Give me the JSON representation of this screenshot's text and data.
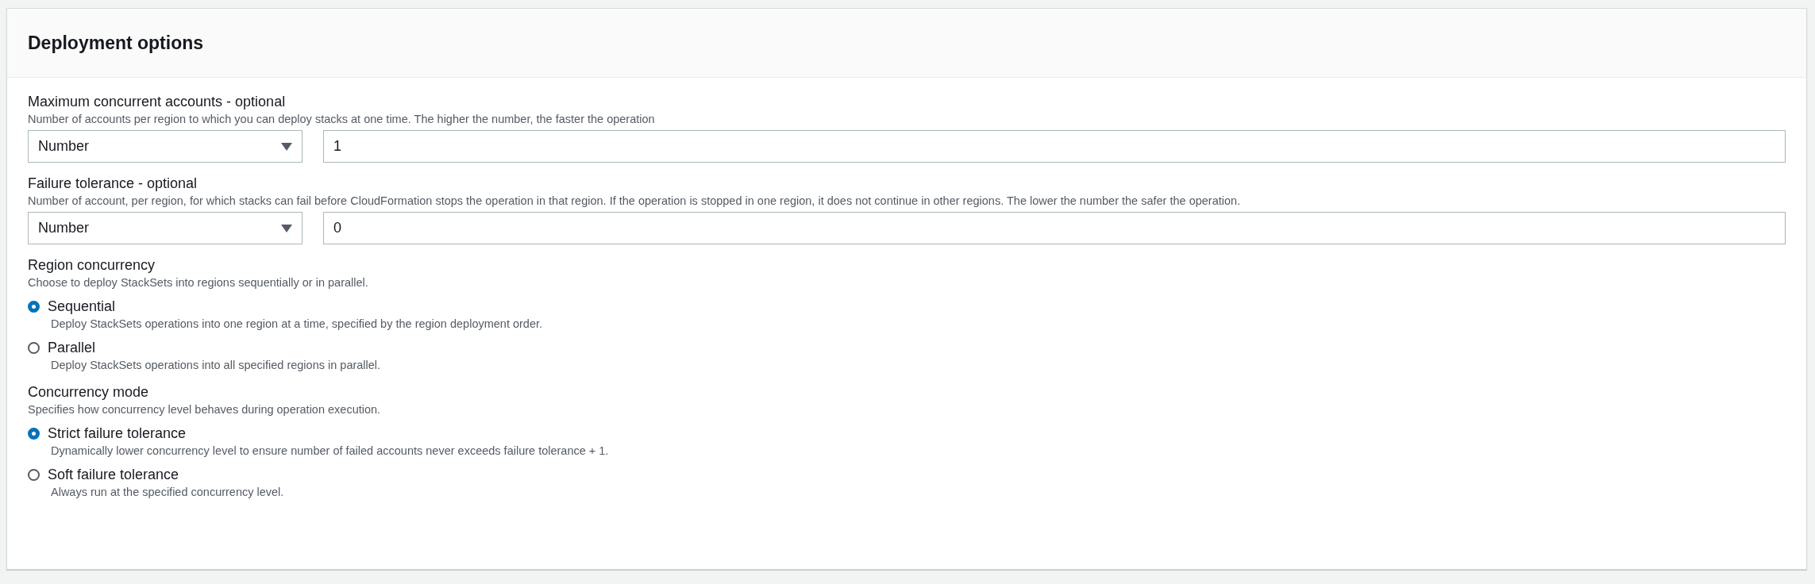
{
  "panel": {
    "title": "Deployment options"
  },
  "number_fields": [
    {
      "label": "Maximum concurrent accounts - optional",
      "description": "Number of accounts per region to which you can deploy stacks at one time. The higher the number, the faster the operation",
      "select_value": "Number",
      "value": "1"
    },
    {
      "label": "Failure tolerance - optional",
      "description": "Number of account, per region, for which stacks can fail before CloudFormation stops the operation in that region. If the operation is stopped in one region, it does not continue in other regions. The lower the number the safer the operation.",
      "select_value": "Number",
      "value": "0"
    }
  ],
  "radio_groups": [
    {
      "label": "Region concurrency",
      "description": "Choose to deploy StackSets into regions sequentially or in parallel.",
      "options": [
        {
          "label": "Sequential",
          "description": "Deploy StackSets operations into one region at a time, specified by the region deployment order.",
          "selected": true
        },
        {
          "label": "Parallel",
          "description": "Deploy StackSets operations into all specified regions in parallel.",
          "selected": false
        }
      ]
    },
    {
      "label": "Concurrency mode",
      "description": "Specifies how concurrency level behaves during operation execution.",
      "options": [
        {
          "label": "Strict failure tolerance",
          "description": "Dynamically lower concurrency level to ensure number of failed accounts never exceeds failure tolerance + 1.",
          "selected": true
        },
        {
          "label": "Soft failure tolerance",
          "description": "Always run at the specified concurrency level.",
          "selected": false
        }
      ]
    }
  ]
}
